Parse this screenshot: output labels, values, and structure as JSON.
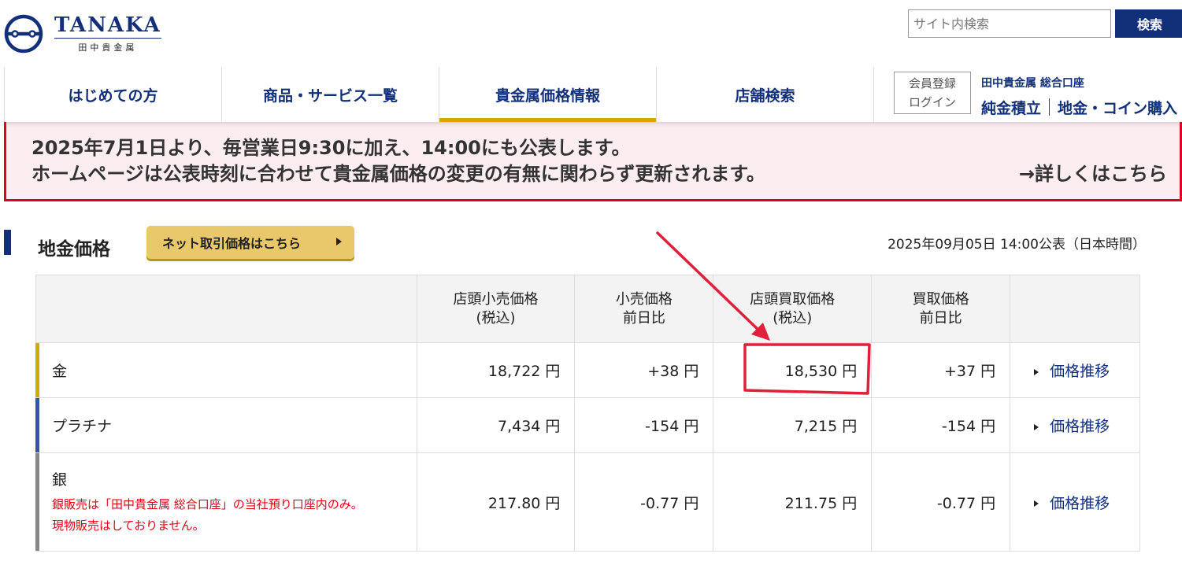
{
  "header": {
    "logo_en": "TANAKA",
    "logo_jp": "田中貴金属",
    "search_placeholder": "サイト内検索",
    "search_button": "検索"
  },
  "nav": {
    "items": [
      {
        "label": "はじめての方",
        "active": false
      },
      {
        "label": "商品・サービス一覧",
        "active": false
      },
      {
        "label": "貴金属価格情報",
        "active": true
      },
      {
        "label": "店舗検索",
        "active": false
      }
    ],
    "member_line1": "会員登録",
    "member_line2": "ログイン",
    "account_title": "田中貴金属 総合口座",
    "account_link1": "純金積立",
    "account_link2": "地金・コイン購入"
  },
  "notice": {
    "line1": "2025年7月1日より、毎営業日9:30に加え、14:00にも公表します。",
    "line2": "ホームページは公表時刻に合わせて貴金属価格の変更の有無に関わらず更新されます。",
    "link": "→詳しくはこちら"
  },
  "section": {
    "title": "地金価格",
    "net_button": "ネット取引価格はこちら",
    "published": "2025年09月05日 14:00公表（日本時間）"
  },
  "table": {
    "headers": [
      [
        "店頭小売価格",
        "(税込)"
      ],
      [
        "小売価格",
        "前日比"
      ],
      [
        "店頭買取価格",
        "(税込)"
      ],
      [
        "買取価格",
        "前日比"
      ]
    ],
    "rows": [
      {
        "metal": "金",
        "retail": "18,722 円",
        "retail_diff": "+38 円",
        "buy": "18,530 円",
        "buy_diff": "+37 円",
        "trend": "価格推移",
        "color": "#d4a900"
      },
      {
        "metal": "プラチナ",
        "retail": "7,434 円",
        "retail_diff": "-154 円",
        "buy": "7,215 円",
        "buy_diff": "-154 円",
        "trend": "価格推移",
        "color": "#2b5aa8"
      },
      {
        "metal": "銀",
        "retail": "217.80 円",
        "retail_diff": "-0.77 円",
        "buy": "211.75 円",
        "buy_diff": "-0.77 円",
        "trend": "価格推移",
        "color": "#888888",
        "note1": "銀販売は「田中貴金属 総合口座」の当社預り口座内のみ。",
        "note2": "現物販売はしておりません。"
      }
    ]
  },
  "colors": {
    "brand_navy": "#12307a",
    "gold_accent": "#d4a900",
    "notice_red": "#e00020",
    "annotation_red": "#e0203a"
  }
}
